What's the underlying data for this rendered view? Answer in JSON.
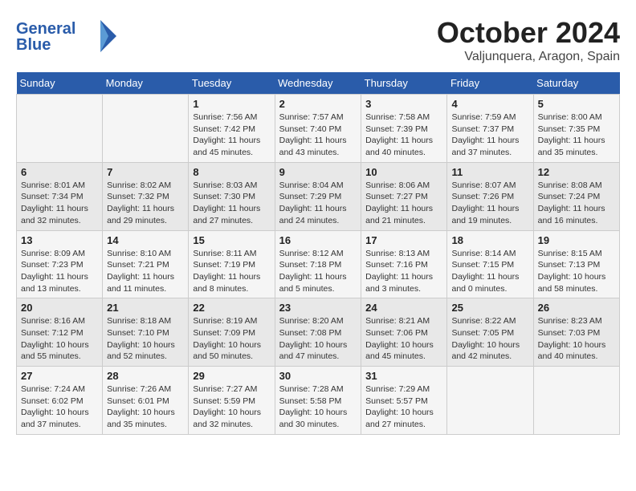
{
  "logo": {
    "line1": "General",
    "line2": "Blue"
  },
  "title": "October 2024",
  "location": "Valjunquera, Aragon, Spain",
  "headers": [
    "Sunday",
    "Monday",
    "Tuesday",
    "Wednesday",
    "Thursday",
    "Friday",
    "Saturday"
  ],
  "weeks": [
    [
      {
        "day": "",
        "info": ""
      },
      {
        "day": "",
        "info": ""
      },
      {
        "day": "1",
        "info": "Sunrise: 7:56 AM\nSunset: 7:42 PM\nDaylight: 11 hours and 45 minutes."
      },
      {
        "day": "2",
        "info": "Sunrise: 7:57 AM\nSunset: 7:40 PM\nDaylight: 11 hours and 43 minutes."
      },
      {
        "day": "3",
        "info": "Sunrise: 7:58 AM\nSunset: 7:39 PM\nDaylight: 11 hours and 40 minutes."
      },
      {
        "day": "4",
        "info": "Sunrise: 7:59 AM\nSunset: 7:37 PM\nDaylight: 11 hours and 37 minutes."
      },
      {
        "day": "5",
        "info": "Sunrise: 8:00 AM\nSunset: 7:35 PM\nDaylight: 11 hours and 35 minutes."
      }
    ],
    [
      {
        "day": "6",
        "info": "Sunrise: 8:01 AM\nSunset: 7:34 PM\nDaylight: 11 hours and 32 minutes."
      },
      {
        "day": "7",
        "info": "Sunrise: 8:02 AM\nSunset: 7:32 PM\nDaylight: 11 hours and 29 minutes."
      },
      {
        "day": "8",
        "info": "Sunrise: 8:03 AM\nSunset: 7:30 PM\nDaylight: 11 hours and 27 minutes."
      },
      {
        "day": "9",
        "info": "Sunrise: 8:04 AM\nSunset: 7:29 PM\nDaylight: 11 hours and 24 minutes."
      },
      {
        "day": "10",
        "info": "Sunrise: 8:06 AM\nSunset: 7:27 PM\nDaylight: 11 hours and 21 minutes."
      },
      {
        "day": "11",
        "info": "Sunrise: 8:07 AM\nSunset: 7:26 PM\nDaylight: 11 hours and 19 minutes."
      },
      {
        "day": "12",
        "info": "Sunrise: 8:08 AM\nSunset: 7:24 PM\nDaylight: 11 hours and 16 minutes."
      }
    ],
    [
      {
        "day": "13",
        "info": "Sunrise: 8:09 AM\nSunset: 7:23 PM\nDaylight: 11 hours and 13 minutes."
      },
      {
        "day": "14",
        "info": "Sunrise: 8:10 AM\nSunset: 7:21 PM\nDaylight: 11 hours and 11 minutes."
      },
      {
        "day": "15",
        "info": "Sunrise: 8:11 AM\nSunset: 7:19 PM\nDaylight: 11 hours and 8 minutes."
      },
      {
        "day": "16",
        "info": "Sunrise: 8:12 AM\nSunset: 7:18 PM\nDaylight: 11 hours and 5 minutes."
      },
      {
        "day": "17",
        "info": "Sunrise: 8:13 AM\nSunset: 7:16 PM\nDaylight: 11 hours and 3 minutes."
      },
      {
        "day": "18",
        "info": "Sunrise: 8:14 AM\nSunset: 7:15 PM\nDaylight: 11 hours and 0 minutes."
      },
      {
        "day": "19",
        "info": "Sunrise: 8:15 AM\nSunset: 7:13 PM\nDaylight: 10 hours and 58 minutes."
      }
    ],
    [
      {
        "day": "20",
        "info": "Sunrise: 8:16 AM\nSunset: 7:12 PM\nDaylight: 10 hours and 55 minutes."
      },
      {
        "day": "21",
        "info": "Sunrise: 8:18 AM\nSunset: 7:10 PM\nDaylight: 10 hours and 52 minutes."
      },
      {
        "day": "22",
        "info": "Sunrise: 8:19 AM\nSunset: 7:09 PM\nDaylight: 10 hours and 50 minutes."
      },
      {
        "day": "23",
        "info": "Sunrise: 8:20 AM\nSunset: 7:08 PM\nDaylight: 10 hours and 47 minutes."
      },
      {
        "day": "24",
        "info": "Sunrise: 8:21 AM\nSunset: 7:06 PM\nDaylight: 10 hours and 45 minutes."
      },
      {
        "day": "25",
        "info": "Sunrise: 8:22 AM\nSunset: 7:05 PM\nDaylight: 10 hours and 42 minutes."
      },
      {
        "day": "26",
        "info": "Sunrise: 8:23 AM\nSunset: 7:03 PM\nDaylight: 10 hours and 40 minutes."
      }
    ],
    [
      {
        "day": "27",
        "info": "Sunrise: 7:24 AM\nSunset: 6:02 PM\nDaylight: 10 hours and 37 minutes."
      },
      {
        "day": "28",
        "info": "Sunrise: 7:26 AM\nSunset: 6:01 PM\nDaylight: 10 hours and 35 minutes."
      },
      {
        "day": "29",
        "info": "Sunrise: 7:27 AM\nSunset: 5:59 PM\nDaylight: 10 hours and 32 minutes."
      },
      {
        "day": "30",
        "info": "Sunrise: 7:28 AM\nSunset: 5:58 PM\nDaylight: 10 hours and 30 minutes."
      },
      {
        "day": "31",
        "info": "Sunrise: 7:29 AM\nSunset: 5:57 PM\nDaylight: 10 hours and 27 minutes."
      },
      {
        "day": "",
        "info": ""
      },
      {
        "day": "",
        "info": ""
      }
    ]
  ]
}
